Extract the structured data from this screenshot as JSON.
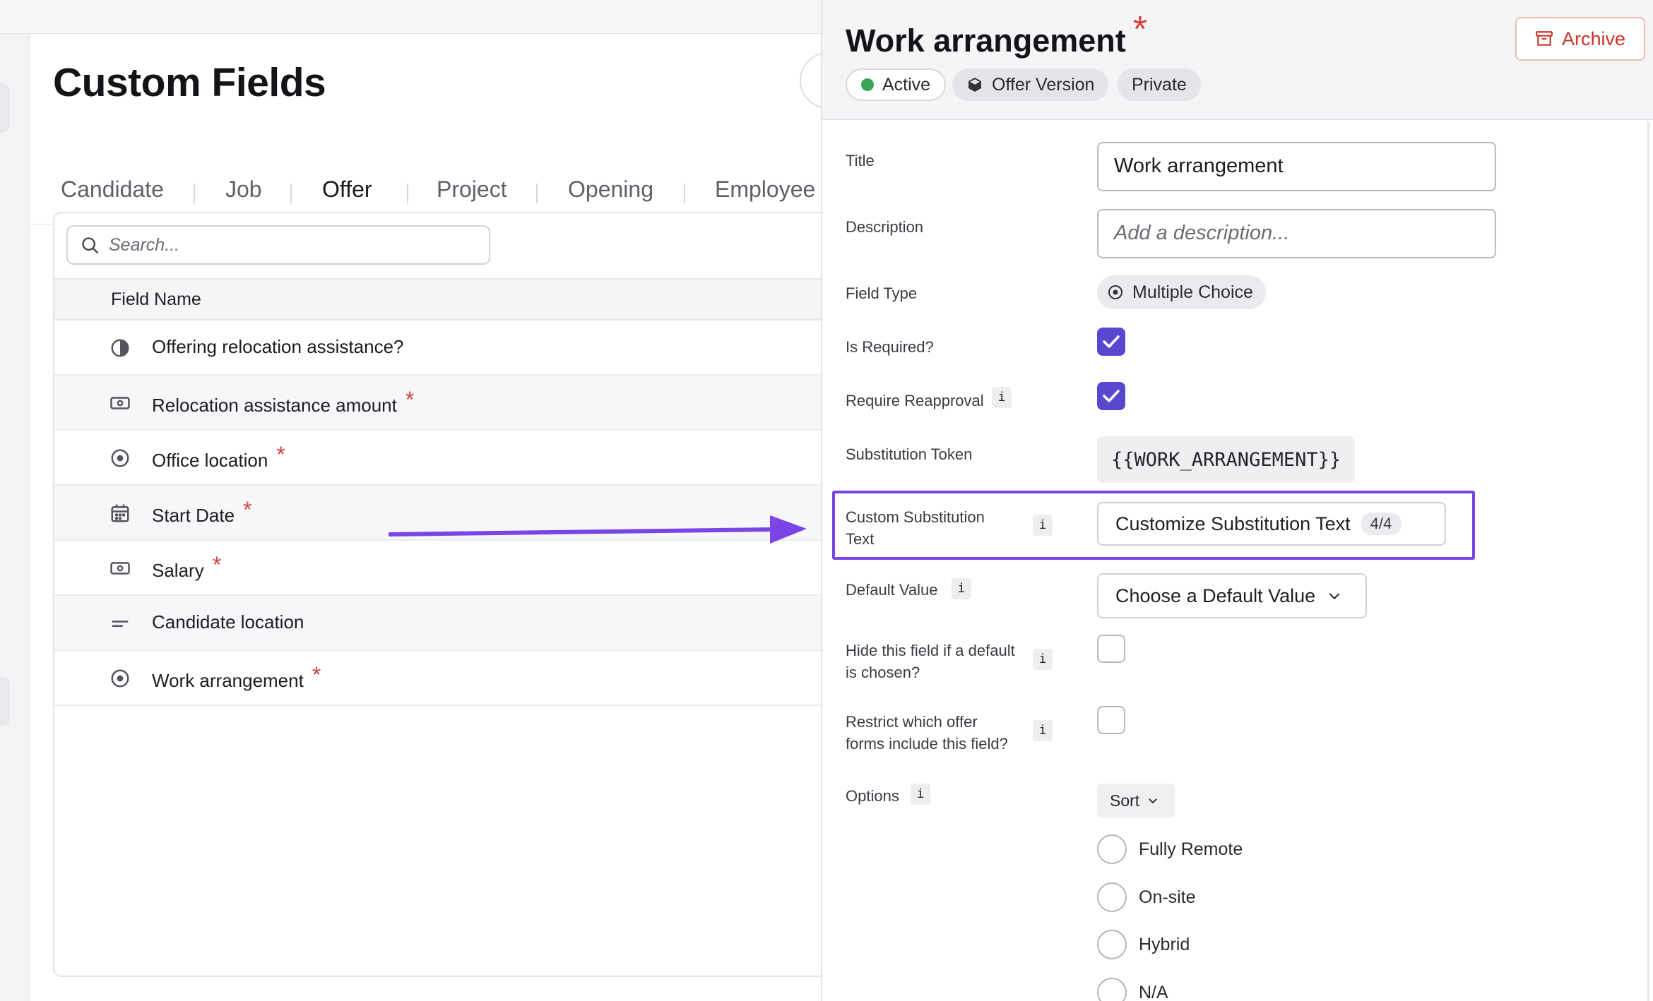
{
  "page": {
    "title": "Custom Fields",
    "tabs": [
      {
        "label": "Candidate"
      },
      {
        "label": "Job"
      },
      {
        "label": "Offer",
        "active": true
      },
      {
        "label": "Project"
      },
      {
        "label": "Opening"
      },
      {
        "label": "Employee"
      }
    ],
    "search": {
      "placeholder": "Search..."
    },
    "table": {
      "column_header": "Field Name",
      "rows": [
        {
          "label": "Offering relocation assistance?",
          "icon": "half-circle-icon",
          "required": false
        },
        {
          "label": "Relocation assistance amount",
          "icon": "currency-icon",
          "required": true
        },
        {
          "label": "Office location",
          "icon": "radio-icon",
          "required": true
        },
        {
          "label": "Start Date",
          "icon": "calendar-icon",
          "required": true
        },
        {
          "label": "Salary",
          "icon": "currency-icon",
          "required": true
        },
        {
          "label": "Candidate location",
          "icon": "text-lines-icon",
          "required": false
        },
        {
          "label": "Work arrangement",
          "icon": "radio-icon",
          "required": true
        }
      ]
    },
    "required_marker": "*"
  },
  "drawer": {
    "title": "Work arrangement",
    "required_marker": "*",
    "badges": {
      "status": "Active",
      "version": "Offer Version",
      "visibility": "Private"
    },
    "archive_label": "Archive",
    "fields": {
      "title_label": "Title",
      "title_value": "Work arrangement",
      "description_label": "Description",
      "description_placeholder": "Add a description...",
      "field_type_label": "Field Type",
      "field_type_value": "Multiple Choice",
      "is_required_label": "Is Required?",
      "is_required": true,
      "require_reapproval_label": "Require Reapproval",
      "require_reapproval": true,
      "token_label": "Substitution Token",
      "token_value": "{{WORK_ARRANGEMENT}}",
      "custom_sub_label_1": "Custom Substitution",
      "custom_sub_label_2": "Text",
      "custom_sub_button": "Customize Substitution Text",
      "custom_sub_count": "4/4",
      "default_label": "Default Value",
      "default_button": "Choose a Default Value",
      "hide_label_1": "Hide this field if a default",
      "hide_label_2": "is chosen?",
      "hide_checked": false,
      "restrict_label_1": "Restrict which offer",
      "restrict_label_2": "forms include this field?",
      "restrict_checked": false,
      "options_label": "Options",
      "sort_label": "Sort",
      "options": [
        "Fully Remote",
        "On-site",
        "Hybrid",
        "N/A"
      ],
      "info_glyph": "i"
    }
  },
  "colors": {
    "accent": "#5a47d0",
    "highlight": "#7b45e6",
    "required": "#d0433c",
    "active_dot": "#3aa35a",
    "archive": "#c8332b"
  }
}
